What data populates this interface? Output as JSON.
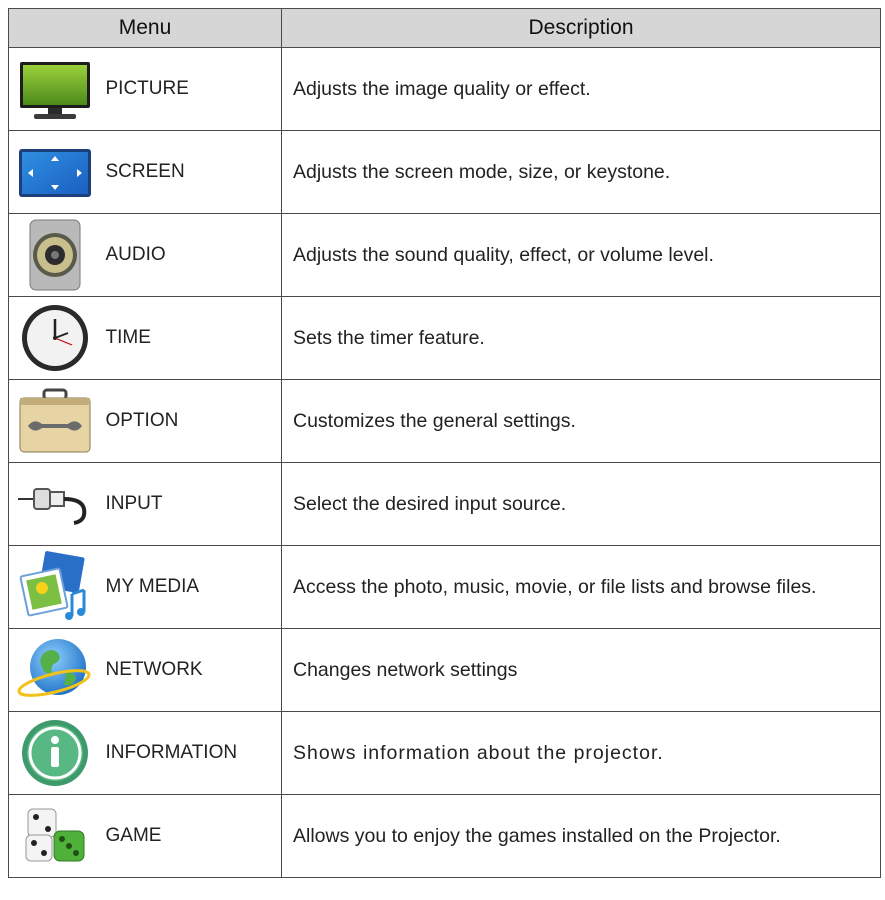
{
  "table": {
    "headers": {
      "menu": "Menu",
      "description": "Description"
    },
    "rows": [
      {
        "icon": "monitor-icon",
        "name": "PICTURE",
        "description": "Adjusts the image quality or effect."
      },
      {
        "icon": "screen-arrows-icon",
        "name": "SCREEN",
        "description": "Adjusts the screen mode, size, or keystone."
      },
      {
        "icon": "speaker-icon",
        "name": "AUDIO",
        "description": "Adjusts the sound quality, effect, or volume level."
      },
      {
        "icon": "clock-icon",
        "name": "TIME",
        "description": "Sets the timer feature."
      },
      {
        "icon": "toolbox-wrench-icon",
        "name": "OPTION",
        "description": "Customizes the general settings."
      },
      {
        "icon": "cable-plug-icon",
        "name": "INPUT",
        "description": "Select the desired input source."
      },
      {
        "icon": "media-files-icon",
        "name": "MY MEDIA",
        "description": "Access the photo, music, movie, or file lists and browse files."
      },
      {
        "icon": "globe-icon",
        "name": "NETWORK",
        "description": "Changes network settings"
      },
      {
        "icon": "info-icon",
        "name": "INFORMATION",
        "description": "Shows information about the projector."
      },
      {
        "icon": "dice-icon",
        "name": "GAME",
        "description": "Allows you to enjoy the games installed on the Projector."
      }
    ]
  },
  "colors": {
    "header_bg": "#d6d6d6",
    "border": "#4a4a4a"
  }
}
